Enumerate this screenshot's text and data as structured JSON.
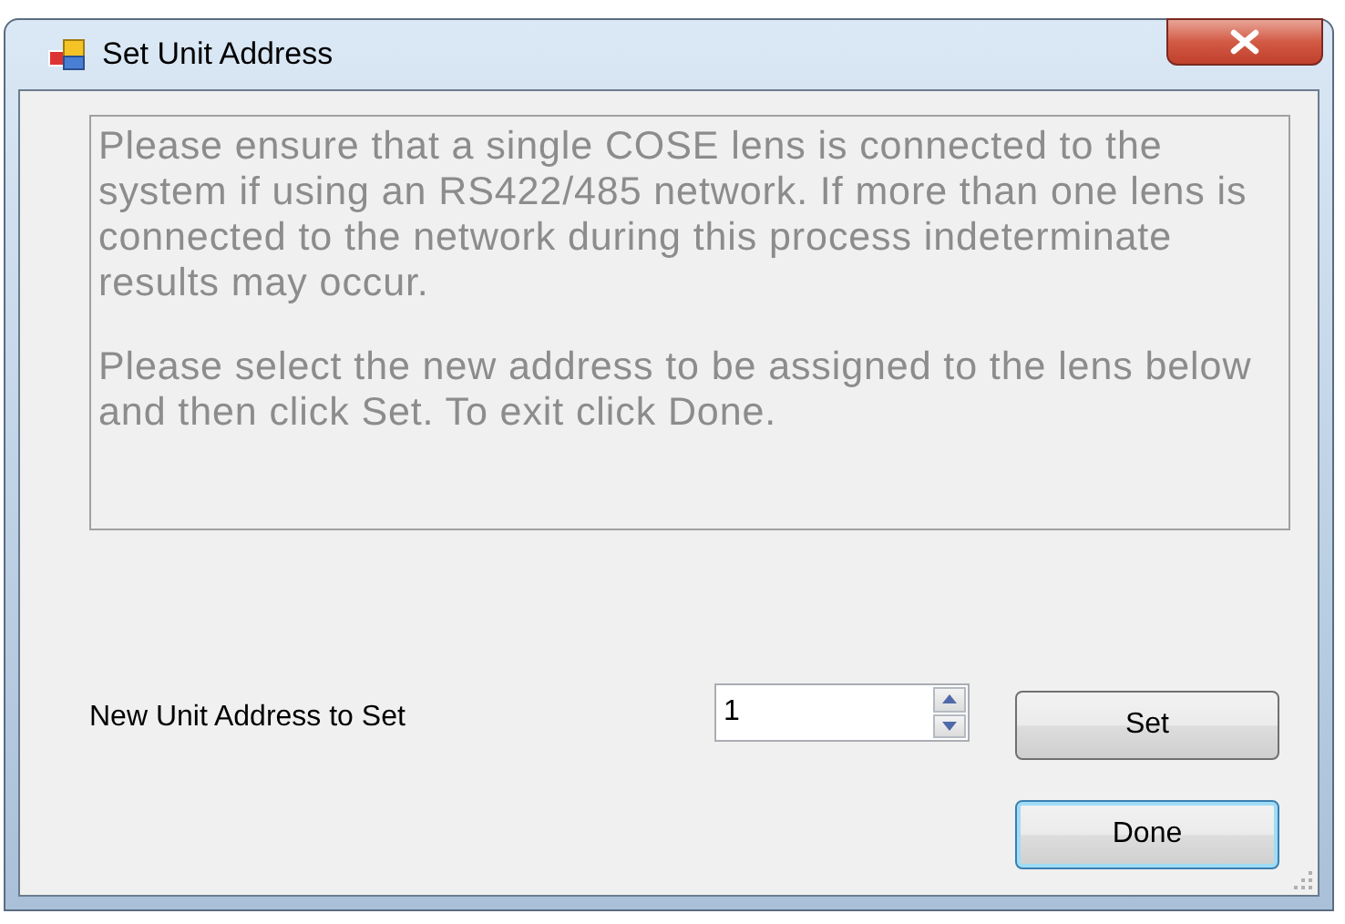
{
  "window": {
    "title": "Set Unit Address"
  },
  "message": {
    "disabled": true,
    "paragraphs": [
      "Please ensure that a single COSE lens is connected to the system if using an RS422/485 network. If more than one lens is connected to the network during this process indeterminate results may occur.",
      "Please select the new address to be assigned to the lens below and then click Set. To exit click Done."
    ]
  },
  "address": {
    "label": "New Unit Address to Set",
    "value": "1"
  },
  "buttons": [
    {
      "label": "Set",
      "default": false
    },
    {
      "label": "Done",
      "default": true
    }
  ]
}
